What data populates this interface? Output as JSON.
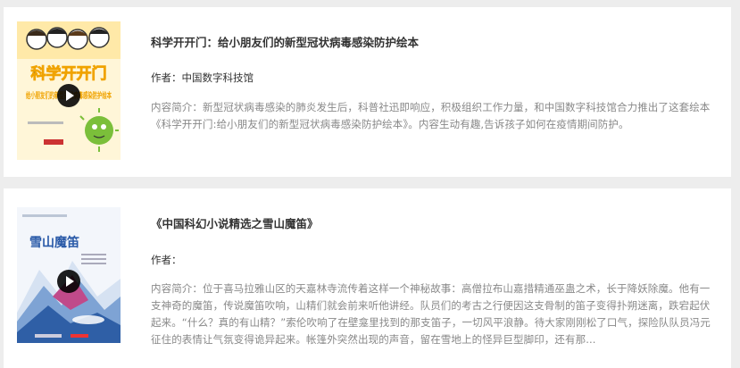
{
  "items": [
    {
      "title": "科学开开门：给小朋友们的新型冠状病毒感染防护绘本",
      "author_label": "作者：中国数字科技馆",
      "intro_label": "内容简介：",
      "intro": "新型冠状病毒感染的肺炎发生后，科普社迅即响应，积极组织工作力量，和中国数字科技馆合力推出了这套绘本《科学开开门:给小朋友们的新型冠状病毒感染防护绘本》。内容生动有趣,告诉孩子如何在疫情期间防护。",
      "cover": {
        "title_text": "科学开开门",
        "subtitle_text": "给小朋友们的新型冠状病毒感染防护绘本",
        "accent": "#f0a300",
        "bg": "#fff6d8"
      }
    },
    {
      "title": "《中国科幻小说精选之雪山魔笛》",
      "author_label": "作者：",
      "intro_label": "内容简介：",
      "intro": "位于喜马拉雅山区的天嘉林寺流传着这样一个神秘故事：高僧拉布山嘉措精通巫蛊之术，长于降妖除魔。他有一支神奇的魔笛，传说魔笛吹响，山精们就会前来听他讲经。队员们的考古之行便因这支骨制的笛子变得扑朔迷离，跌宕起伏起来。“什么？真的有山精？”索伦吹响了在壁龛里找到的那支笛子，一切风平浪静。待大家刚刚松了口气，探险队队员冯元征住的表情让气氛变得诡异起来。帐篷外突然出现的声音，留在雪地上的怪异巨型脚印，还有那...",
      "cover": {
        "title_text": "雪山魔笛",
        "accent": "#2a5aa8",
        "bg": "#f3f6fb"
      }
    }
  ]
}
